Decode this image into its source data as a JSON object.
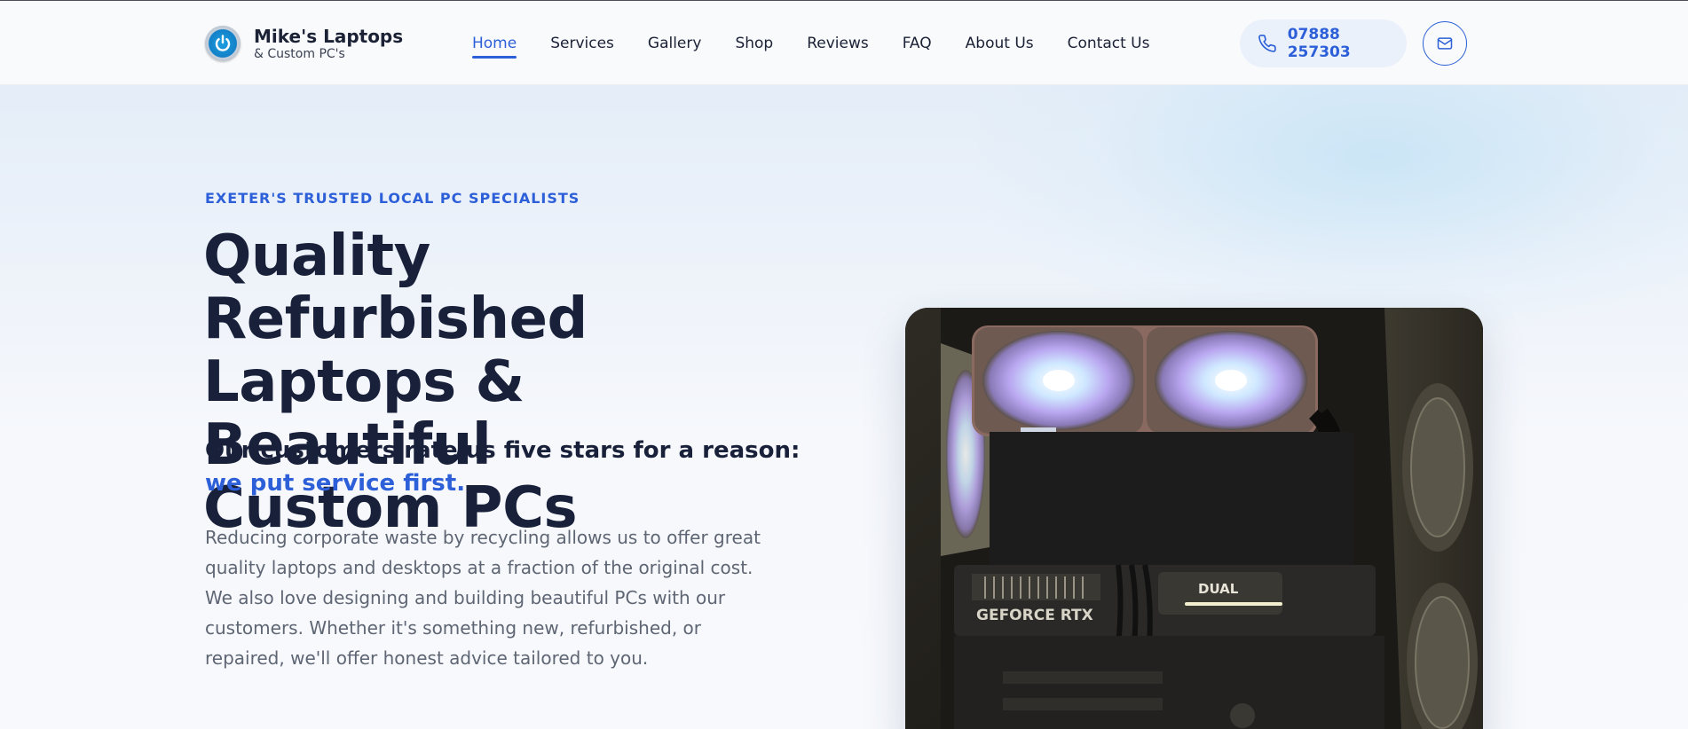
{
  "brand": {
    "name": "Mike's Laptops",
    "tagline": "& Custom PC's",
    "logo_icon": "power-icon"
  },
  "nav": {
    "items": [
      {
        "label": "Home",
        "active": true
      },
      {
        "label": "Services",
        "active": false
      },
      {
        "label": "Gallery",
        "active": false
      },
      {
        "label": "Shop",
        "active": false
      },
      {
        "label": "Reviews",
        "active": false
      },
      {
        "label": "FAQ",
        "active": false
      },
      {
        "label": "About Us",
        "active": false
      },
      {
        "label": "Contact Us",
        "active": false
      }
    ]
  },
  "contact": {
    "phone": "07888 257303",
    "phone_icon": "phone-icon",
    "mail_icon": "mail-icon"
  },
  "hero": {
    "eyebrow": "EXETER'S TRUSTED LOCAL PC SPECIALISTS",
    "title_line1": "Quality Refurbished",
    "title_line2": "Laptops & Beautiful",
    "title_line3": "Custom PCs",
    "lead": "Our customers rate us five stars for a reason: ",
    "lead_accent": "we put service first.",
    "body": "Reducing corporate waste by recycling allows us to offer great quality laptops and desktops at a fraction of the original cost. We also love designing and building beautiful PCs with our customers. Whether it's something new, refurbished, or repaired, we'll offer honest advice tailored to you.",
    "photo": {
      "subject": "custom PC interior with RGB fans and graphics card",
      "gpu_text_1": "GEFORCE RTX",
      "gpu_text_2": "DUAL"
    }
  },
  "colors": {
    "accent": "#2c5fd8",
    "heading": "#18203a",
    "body": "#5e6573",
    "pill_bg": "#ebf1fb"
  }
}
